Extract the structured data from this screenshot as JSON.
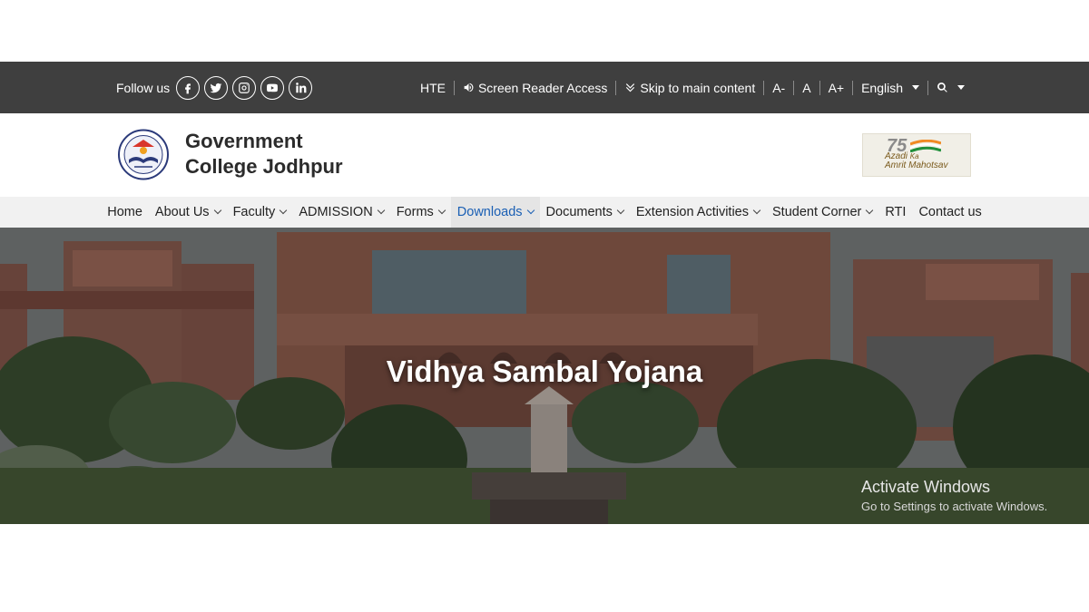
{
  "topbar": {
    "follow_label": "Follow us",
    "social": [
      {
        "icon": "facebook-icon",
        "glyph": "f"
      },
      {
        "icon": "twitter-icon"
      },
      {
        "icon": "instagram-icon"
      },
      {
        "icon": "youtube-icon"
      },
      {
        "icon": "linkedin-icon",
        "glyph": "in"
      }
    ],
    "hte_label": "HTE",
    "screen_reader_label": "Screen Reader Access",
    "skip_label": "Skip to main content",
    "font_decrease": "A-",
    "font_normal": "A",
    "font_increase": "A+",
    "language": "English"
  },
  "header": {
    "name_line1": "Government",
    "name_line2": "College Jodhpur",
    "azadi_number": "75",
    "azadi_line1": "Azadi",
    "azadi_ka": "Ka",
    "azadi_line2": "Amrit Mahotsav"
  },
  "nav": {
    "items": [
      {
        "label": "Home",
        "dropdown": false
      },
      {
        "label": "About Us",
        "dropdown": true
      },
      {
        "label": "Faculty",
        "dropdown": true
      },
      {
        "label": "ADMISSION",
        "dropdown": true
      },
      {
        "label": "Forms",
        "dropdown": true
      },
      {
        "label": "Downloads",
        "dropdown": true,
        "active": true
      },
      {
        "label": "Documents",
        "dropdown": true
      },
      {
        "label": "Extension Activities",
        "dropdown": true
      },
      {
        "label": "Student Corner",
        "dropdown": true
      },
      {
        "label": "RTI",
        "dropdown": false
      },
      {
        "label": "Contact us",
        "dropdown": false
      }
    ]
  },
  "hero": {
    "title": "Vidhya Sambal Yojana"
  },
  "watermark": {
    "title": "Activate Windows",
    "subtitle": "Go to Settings to activate Windows."
  },
  "colors": {
    "topbar": "#3f3f3f",
    "nav_bg": "#f1f1f1",
    "active_link": "#1a5fb4"
  }
}
